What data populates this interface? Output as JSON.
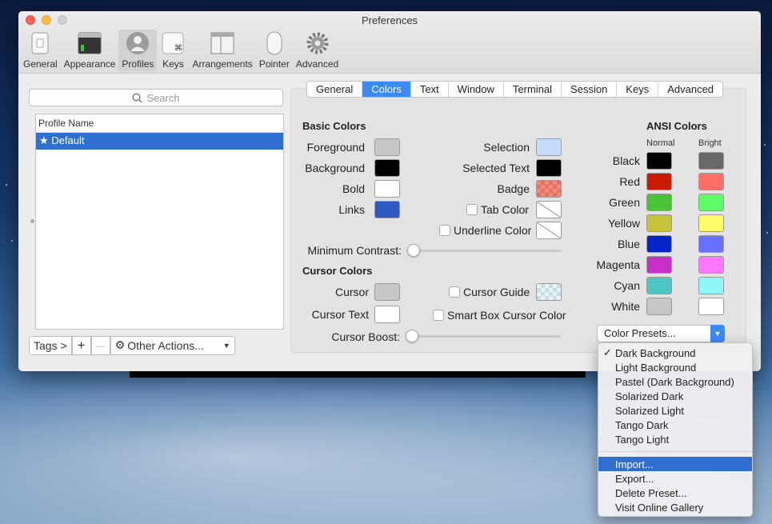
{
  "window": {
    "title": "Preferences"
  },
  "toolbar": {
    "items": [
      {
        "label": "General",
        "icon": "switch-icon"
      },
      {
        "label": "Appearance",
        "icon": "appearance-icon"
      },
      {
        "label": "Profiles",
        "icon": "person-icon",
        "selected": true
      },
      {
        "label": "Keys",
        "icon": "command-key-icon"
      },
      {
        "label": "Arrangements",
        "icon": "windows-icon"
      },
      {
        "label": "Pointer",
        "icon": "mouse-icon"
      },
      {
        "label": "Advanced",
        "icon": "gear-icon"
      }
    ]
  },
  "search": {
    "placeholder": "Search"
  },
  "profiles": {
    "header": "Profile Name",
    "items": [
      {
        "label": "★ Default",
        "selected": true
      }
    ]
  },
  "bottom_bar": {
    "tags": "Tags >",
    "add": "+",
    "remove": "—",
    "other_actions": "Other Actions..."
  },
  "tabs": [
    "General",
    "Colors",
    "Text",
    "Window",
    "Terminal",
    "Session",
    "Keys",
    "Advanced"
  ],
  "selected_tab": "Colors",
  "basic_colors": {
    "title": "Basic Colors",
    "foreground": {
      "label": "Foreground",
      "color": "#c7c7c7"
    },
    "background": {
      "label": "Background",
      "color": "#000000"
    },
    "bold": {
      "label": "Bold",
      "color": "#ffffff"
    },
    "links": {
      "label": "Links",
      "color": "#2c59c2"
    },
    "selection": {
      "label": "Selection",
      "color": "#c6dcfb"
    },
    "selected_text": {
      "label": "Selected Text",
      "color": "#000000"
    },
    "badge": {
      "label": "Badge",
      "color": "#f08a7a"
    },
    "tab_color": {
      "label": "Tab Color"
    },
    "underline_color": {
      "label": "Underline Color"
    },
    "min_contrast": "Minimum Contrast:"
  },
  "cursor_colors": {
    "title": "Cursor Colors",
    "cursor": {
      "label": "Cursor",
      "color": "#c7c7c7"
    },
    "cursor_text": {
      "label": "Cursor Text",
      "color": "#ffffff"
    },
    "cursor_guide": {
      "label": "Cursor Guide"
    },
    "smart_box": {
      "label": "Smart Box Cursor Color"
    },
    "boost": "Cursor Boost:"
  },
  "ansi": {
    "title": "ANSI Colors",
    "normal": "Normal",
    "bright": "Bright",
    "rows": [
      {
        "name": "Black",
        "normal": "#000000",
        "bright": "#686868"
      },
      {
        "name": "Red",
        "normal": "#c91b00",
        "bright": "#ff6e67"
      },
      {
        "name": "Green",
        "normal": "#4ac236",
        "bright": "#5ffa68"
      },
      {
        "name": "Yellow",
        "normal": "#c7c43a",
        "bright": "#fffc67"
      },
      {
        "name": "Blue",
        "normal": "#0225c7",
        "bright": "#6871ff"
      },
      {
        "name": "Magenta",
        "normal": "#c930c7",
        "bright": "#ff77ff"
      },
      {
        "name": "Cyan",
        "normal": "#4dc5c5",
        "bright": "#8ff7f7"
      },
      {
        "name": "White",
        "normal": "#c7c7c7",
        "bright": "#ffffff"
      }
    ]
  },
  "presets": {
    "label": "Color Presets..."
  },
  "menu": {
    "presets": [
      {
        "label": "Dark Background",
        "checked": true
      },
      {
        "label": "Light Background"
      },
      {
        "label": "Pastel (Dark Background)"
      },
      {
        "label": "Solarized Dark"
      },
      {
        "label": "Solarized Light"
      },
      {
        "label": "Tango Dark"
      },
      {
        "label": "Tango Light"
      }
    ],
    "actions": [
      {
        "label": "Import...",
        "highlighted": true
      },
      {
        "label": "Export..."
      },
      {
        "label": "Delete Preset..."
      },
      {
        "label": "Visit Online Gallery"
      }
    ]
  }
}
